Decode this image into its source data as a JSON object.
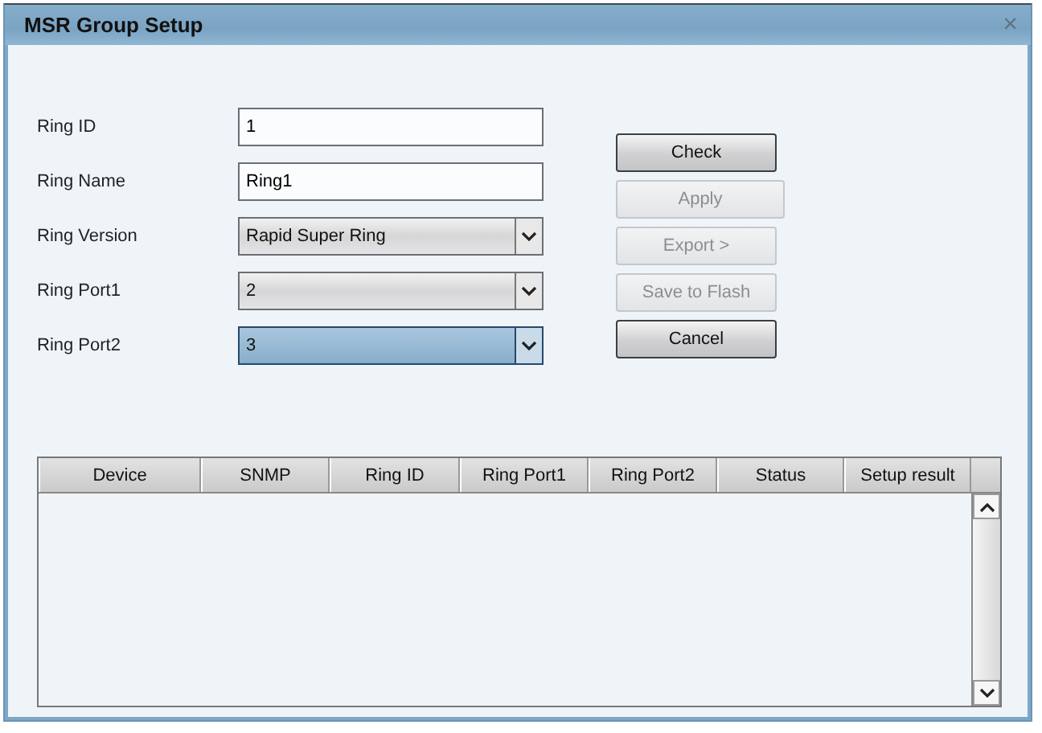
{
  "window": {
    "title": "MSR Group Setup",
    "close": "×"
  },
  "fields": [
    {
      "label": "Ring ID",
      "kind": "text",
      "value": "1",
      "focused": false
    },
    {
      "label": "Ring Name",
      "kind": "text",
      "value": "Ring1",
      "focused": false
    },
    {
      "label": "Ring Version",
      "kind": "select",
      "value": "Rapid Super Ring",
      "focused": false
    },
    {
      "label": "Ring Port1",
      "kind": "select",
      "value": "2",
      "focused": false
    },
    {
      "label": "Ring Port2",
      "kind": "select",
      "value": "3",
      "focused": true
    }
  ],
  "buttons": [
    {
      "label": "Check",
      "disabled": false
    },
    {
      "label": "Apply",
      "disabled": true
    },
    {
      "label": "Export >",
      "disabled": true
    },
    {
      "label": "Save to Flash",
      "disabled": true
    },
    {
      "label": "Cancel",
      "disabled": false
    }
  ],
  "table": {
    "columns": [
      "Device",
      "SNMP",
      "Ring ID",
      "Ring Port1",
      "Ring Port2",
      "Status",
      "Setup result"
    ]
  }
}
